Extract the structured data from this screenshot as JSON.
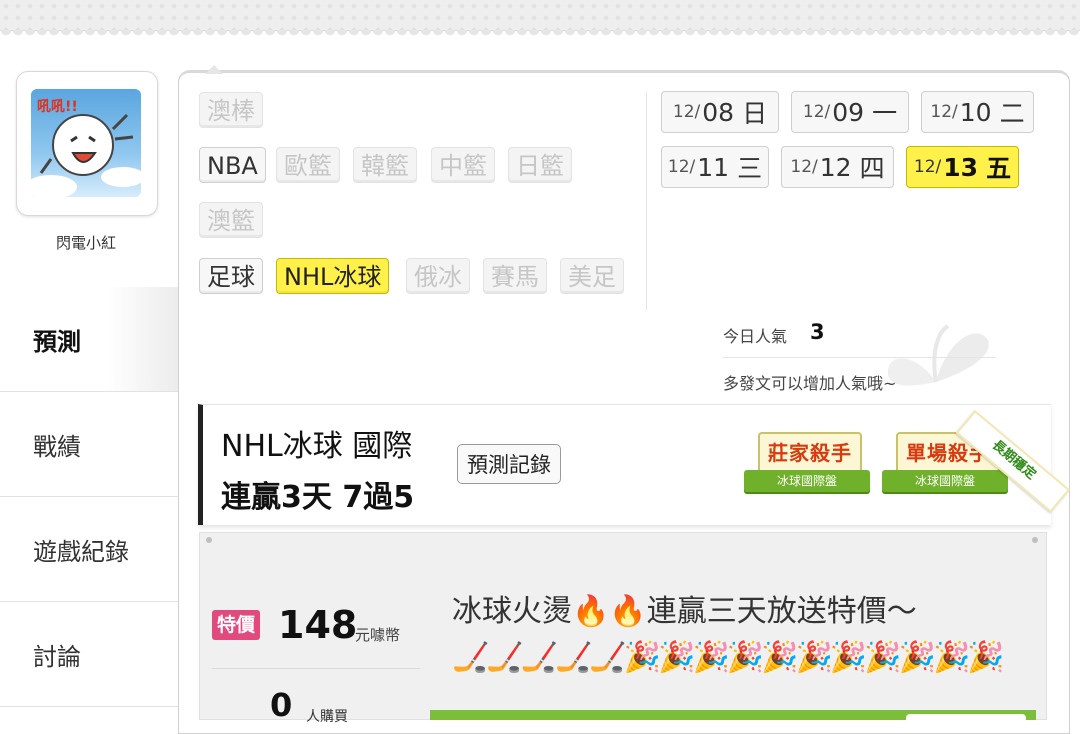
{
  "user": {
    "name": "閃電小紅",
    "avatar_text": "吼吼!!"
  },
  "sidebar": {
    "items": [
      {
        "label": "預測",
        "active": true
      },
      {
        "label": "戰績",
        "active": false
      },
      {
        "label": "遊戲紀錄",
        "active": false
      },
      {
        "label": "討論",
        "active": false
      }
    ]
  },
  "sports": {
    "aus_baseball": "澳棒",
    "nba": "NBA",
    "euro_basket": "歐籃",
    "kor_basket": "韓籃",
    "chn_basket": "中籃",
    "jpn_basket": "日籃",
    "aus_basket": "澳籃",
    "soccer": "足球",
    "nhl": "NHL冰球",
    "rus_hockey": "俄冰",
    "horse_racing": "賽馬",
    "nfl": "美足"
  },
  "dates": [
    {
      "md": "12/",
      "day": "08",
      "weekday": "日"
    },
    {
      "md": "12/",
      "day": "09",
      "weekday": "一"
    },
    {
      "md": "12/",
      "day": "10",
      "weekday": "二"
    },
    {
      "md": "12/",
      "day": "11",
      "weekday": "三"
    },
    {
      "md": "12/",
      "day": "12",
      "weekday": "四"
    },
    {
      "md": "12/",
      "day": "13",
      "weekday": "五"
    }
  ],
  "popularity": {
    "label": "今日人氣",
    "value": "3",
    "tip": "多發文可以增加人氣哦~"
  },
  "record": {
    "title": "NHL冰球 國際",
    "streak": "連贏3天 7過5",
    "button": "預測記錄",
    "badges": [
      {
        "title": "莊家殺手",
        "sub": "冰球國際盤"
      },
      {
        "title": "單場殺手",
        "sub": "冰球國際盤"
      }
    ],
    "corner_label": "長期穩定"
  },
  "promo": {
    "tag": "特價",
    "price": "148",
    "price_unit": "元噱幣",
    "buyers": "0",
    "buyers_unit": "人購買",
    "title": "冰球火燙🔥🔥連贏三天放送特價～",
    "emoji_line": "🏒🏒🏒🏒🏒🎉🎉🎉🎉🎉🎉🎉🎉🎉🎉🎉"
  },
  "colors": {
    "selected_yellow": "#fff04a",
    "special_pink": "#e2497d",
    "badge_green": "#6fb12a",
    "badge_red": "#d83a0f"
  }
}
